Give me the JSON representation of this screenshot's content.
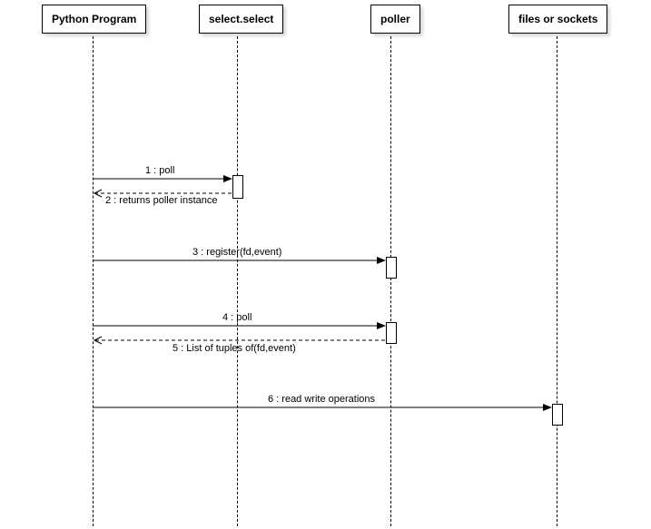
{
  "participants": {
    "p1": "Python Program",
    "p2": "select.select",
    "p3": "poller",
    "p4": "files or sockets"
  },
  "messages": {
    "m1": "1 : poll",
    "m2": "2 : returns poller instance",
    "m3": "3 : register(fd,event)",
    "m4": "4 : poll",
    "m5": "5 : List of tuples of(fd,event)",
    "m6": "6 : read write operations"
  }
}
